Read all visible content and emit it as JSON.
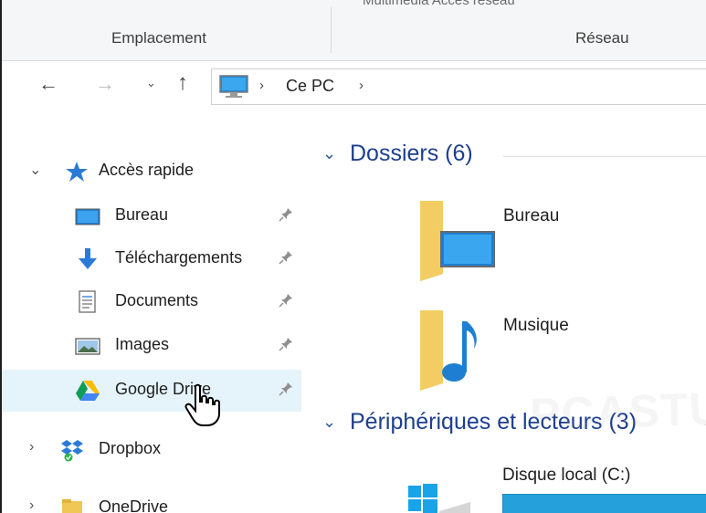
{
  "ribbon": {
    "top_partial_text": "Multimédia      Accès réseau",
    "group_emplacement": "Emplacement",
    "group_reseau": "Réseau"
  },
  "navbar": {
    "back_glyph": "←",
    "forward_glyph": "→",
    "recent_glyph": "⌄",
    "up_glyph": "↑",
    "breadcrumb": [
      "Ce PC"
    ],
    "separator_glyph": "›"
  },
  "sidebar": {
    "quick_access": {
      "label": "Accès rapide",
      "expanded": true,
      "icon": "star-icon"
    },
    "quick_items": [
      {
        "label": "Bureau",
        "icon": "desktop-icon",
        "pinned": true
      },
      {
        "label": "Téléchargements",
        "icon": "download-arrow-icon",
        "pinned": true
      },
      {
        "label": "Documents",
        "icon": "document-icon",
        "pinned": true
      },
      {
        "label": "Images",
        "icon": "image-icon",
        "pinned": true
      },
      {
        "label": "Google Drive",
        "icon": "google-drive-icon",
        "pinned": true,
        "selected": true
      }
    ],
    "dropbox": {
      "label": "Dropbox",
      "icon": "dropbox-icon"
    },
    "onedrive": {
      "label": "OneDrive",
      "icon": "onedrive-icon"
    }
  },
  "content": {
    "folders_header": "Dossiers (6)",
    "folders": [
      {
        "name": "Bureau",
        "icon": "desktop-folder-icon"
      },
      {
        "name": "Musique",
        "icon": "music-folder-icon"
      }
    ],
    "devices_header": "Périphériques et lecteurs (3)",
    "drive": {
      "name": "Disque local (C:)",
      "icon": "windows-drive-icon",
      "used_fraction": 1.0
    }
  },
  "watermark_text": "PCASTUCES",
  "colors": {
    "accent": "#1e3f8f",
    "selection": "#e5f3fb",
    "drive_bar": "#26a0da",
    "folder": "#f0c654"
  }
}
